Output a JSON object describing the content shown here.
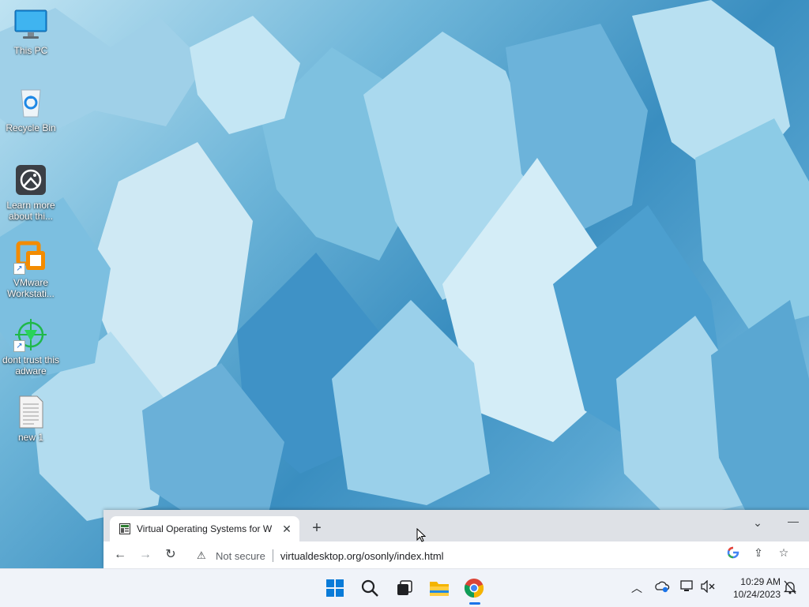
{
  "desktop": {
    "icons": [
      {
        "label": "This PC",
        "icon": "this-pc-icon"
      },
      {
        "label": "Recycle Bin",
        "icon": "recycle-bin-icon"
      },
      {
        "label": "Learn more about thi...",
        "icon": "learn-more-icon"
      },
      {
        "label": "VMware Workstati...",
        "icon": "vmware-icon",
        "shortcut": true
      },
      {
        "label": "dont trust this adware",
        "icon": "target-icon",
        "shortcut": true
      },
      {
        "label": "new 1",
        "icon": "text-file-icon"
      }
    ]
  },
  "browser": {
    "tab_title": "Virtual Operating Systems for W",
    "omnibox": {
      "security_label": "Not secure",
      "url": "virtualdesktop.org/osonly/index.html"
    }
  },
  "taskbar": {
    "clock": {
      "time": "10:29 AM",
      "date": "10/24/2023"
    },
    "pinned": [
      "windows-start-icon",
      "search-icon",
      "task-view-icon",
      "file-explorer-icon",
      "chrome-icon"
    ],
    "tray_icons": [
      "chevron-up-icon",
      "onedrive-icon",
      "network-icon",
      "volume-muted-icon",
      "notification-icon"
    ]
  },
  "colors": {
    "accent": "#1a73e8",
    "taskbar_bg": "#f0f3f9",
    "tab_strip_bg": "#dee1e6"
  }
}
